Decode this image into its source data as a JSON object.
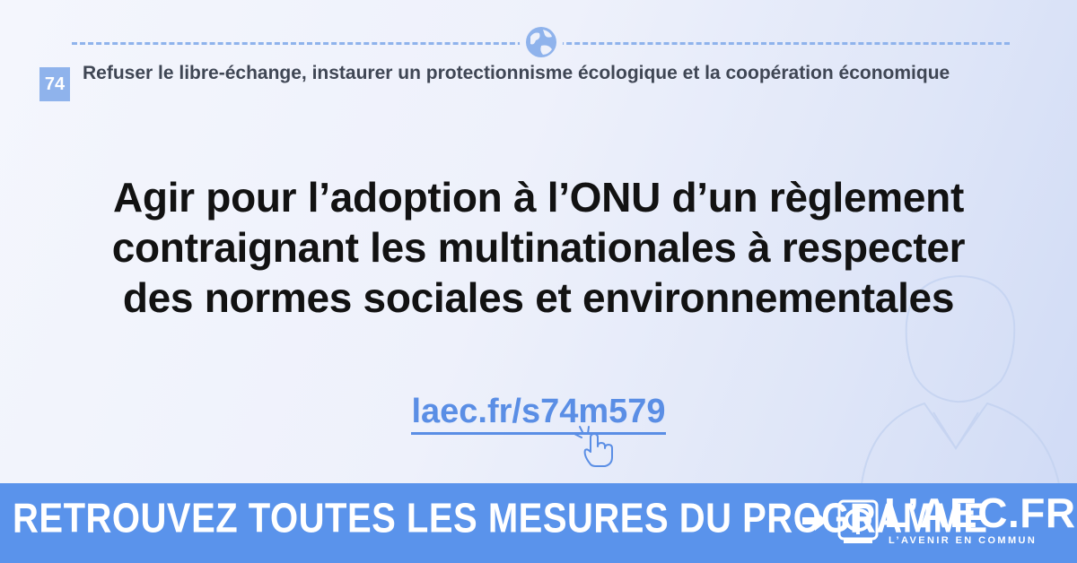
{
  "chapter": {
    "number": "74",
    "title": "Refuser le libre-échange, instaurer un protectionnisme écologique et la coopération économique"
  },
  "headline": {
    "line1": "Agir pour l’adoption à l’ONU d’un règlement",
    "line2": "contraignant les multinationales à respecter",
    "line3": "des normes sociales et environnementales"
  },
  "link": {
    "text": "laec.fr/s74m579"
  },
  "footer": {
    "cta": "RETROUVEZ TOUTES LES MESURES DU PROGRAMME",
    "brand": "L’AEC.FR",
    "tagline": "L’AVENIR EN COMMUN"
  },
  "icons": {
    "globe": "globe-icon",
    "pointer": "pointer-hand-icon",
    "arrow": "arrow-right-icon",
    "logo": "phi-logo-icon"
  },
  "colors": {
    "accent": "#5a93eb",
    "light_accent": "#8fb3ec",
    "text": "#121212"
  }
}
